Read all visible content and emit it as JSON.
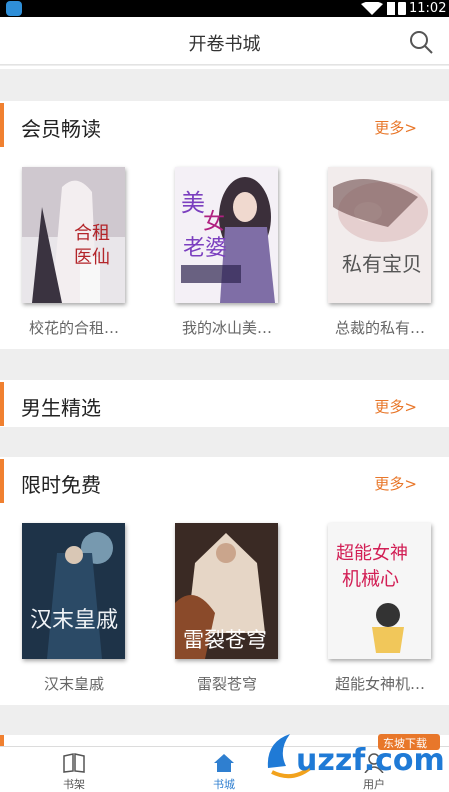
{
  "status": {
    "time": "11:02"
  },
  "header": {
    "title": "开卷书城"
  },
  "sections": [
    {
      "title": "会员畅读",
      "more": "更多>",
      "books": [
        {
          "title": "校花的合租…",
          "cover_text": "校花的合租医仙"
        },
        {
          "title": "我的冰山美…",
          "cover_text": "美女老婆"
        },
        {
          "title": "总裁的私有…",
          "cover_text": "私有宝贝"
        }
      ]
    },
    {
      "title": "男生精选",
      "more": "更多>",
      "books": []
    },
    {
      "title": "限时免费",
      "more": "更多>",
      "books": [
        {
          "title": "汉末皇戚",
          "cover_text": "汉末皇戚"
        },
        {
          "title": "雷裂苍穹",
          "cover_text": "雷裂苍穹"
        },
        {
          "title": "超能女神机…",
          "cover_text": "超能女神机械心"
        }
      ]
    }
  ],
  "nav": {
    "items": [
      {
        "label": "书架"
      },
      {
        "label": "书城"
      },
      {
        "label": "用户"
      }
    ]
  },
  "watermark": {
    "text": "uzzf.com",
    "tag": "东坡下载"
  },
  "colors": {
    "accent": "#f08030",
    "more": "#e8772a",
    "nav_active": "#2f7fd0"
  }
}
